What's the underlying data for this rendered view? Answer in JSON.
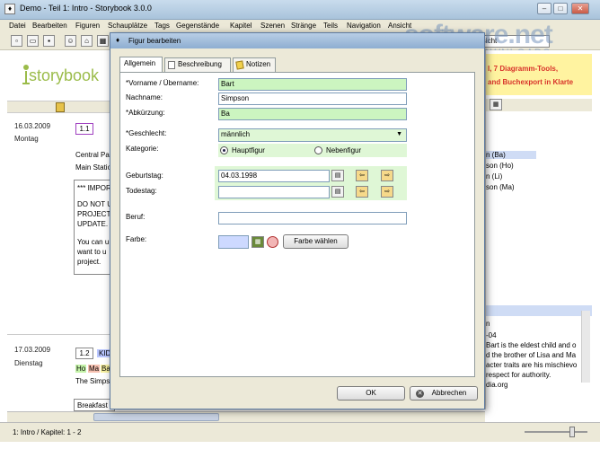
{
  "window": {
    "title": "Demo - Teil 1: Intro - Storybook 3.0.0",
    "min_glyph": "–",
    "max_glyph": "□",
    "close_glyph": "✕"
  },
  "menu": [
    "Datei",
    "Bearbeiten",
    "Figuren",
    "Schauplätze",
    "Tags",
    "Gegenstände",
    "Kapitel",
    "Szenen",
    "Stränge",
    "Teils",
    "Navigation",
    "Ansicht"
  ],
  "toolbar": {
    "search_value": "Ansicht"
  },
  "brand": {
    "label": "storybook"
  },
  "watermark": {
    "line1": "software.net",
    "line2": "AKTUELLE DOWNLOADS"
  },
  "left_panel": {
    "entries": [
      {
        "date": "16.03.2009",
        "weekday": "Montag",
        "scene_number": "1.1",
        "lines": [
          "Central Pa",
          "Main Statio"
        ],
        "box_lines": [
          "*** IMPOR",
          "DO NOT U",
          "PROJECT",
          "UPDATE.",
          "You can u",
          "want to u",
          "project."
        ]
      },
      {
        "date": "17.03.2009",
        "weekday": "Dienstag",
        "scene_number": "1.2",
        "scene_tag": "KID",
        "tags": [
          "Ho",
          "Ma",
          "Ba"
        ],
        "lines": [
          "The Simps"
        ],
        "box_lines": [
          "Breakfast"
        ]
      }
    ]
  },
  "right_panel": {
    "banner_lines": [
      "l, 7 Diagramm-Tools,",
      "and Buchexport in Klarte"
    ],
    "list": [
      "n (Ba)",
      "son (Ho)",
      "n (Li)",
      "son (Ma)"
    ],
    "detail_lines": [
      "n",
      "-04",
      "Bart is the eldest child and o",
      "d the brother of Lisa and Ma",
      "acter traits are his mischievo",
      "respect for authority.",
      "dia.org"
    ]
  },
  "status": {
    "text": "1: Intro / Kapitel: 1 - 2"
  },
  "dialog": {
    "title": "Figur bearbeiten",
    "tabs": [
      "Allgemein",
      "Beschreibung",
      "Notizen"
    ],
    "fields": {
      "vorname_label": "*Vorname / Übername:",
      "vorname_value": "Bart",
      "nachname_label": "Nachname:",
      "nachname_value": "Simpson",
      "abk_label": "*Abkürzung:",
      "abk_value": "Ba",
      "geschlecht_label": "*Geschlecht:",
      "geschlecht_value": "männlich",
      "kategorie_label": "Kategorie:",
      "kategorie_options": [
        "Hauptfigur",
        "Nebenfigur"
      ],
      "kategorie_selected": "Hauptfigur",
      "geburtstag_label": "Geburtstag:",
      "geburtstag_value": "04.03.1998",
      "todestag_label": "Todestag:",
      "todestag_value": "",
      "beruf_label": "Beruf:",
      "beruf_value": "",
      "farbe_label": "Farbe:",
      "farbe_value": "#cdd9ff",
      "farbe_button": "Farbe wählen"
    },
    "ok_label": "OK",
    "cancel_label": "Abbrechen"
  },
  "colors": {
    "required_field": "#ccf5c0",
    "brand": "#9bbc4a"
  }
}
